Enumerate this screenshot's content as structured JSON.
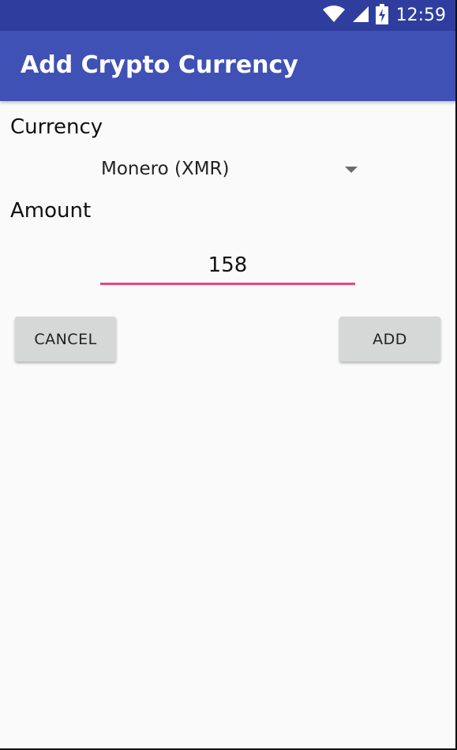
{
  "status_bar": {
    "time": "12:59",
    "icons": [
      "wifi-icon",
      "cell-signal-icon",
      "battery-charging-icon"
    ]
  },
  "app_bar": {
    "title": "Add Crypto Currency"
  },
  "form": {
    "currency_label": "Currency",
    "currency_value": "Monero (XMR)",
    "amount_label": "Amount",
    "amount_value": "158"
  },
  "buttons": {
    "cancel": "CANCEL",
    "add": "ADD"
  },
  "colors": {
    "status_bar": "#2f3e9e",
    "app_bar": "#3f51b5",
    "accent_underline": "#e8467f",
    "button_bg": "#d6d7d7"
  }
}
